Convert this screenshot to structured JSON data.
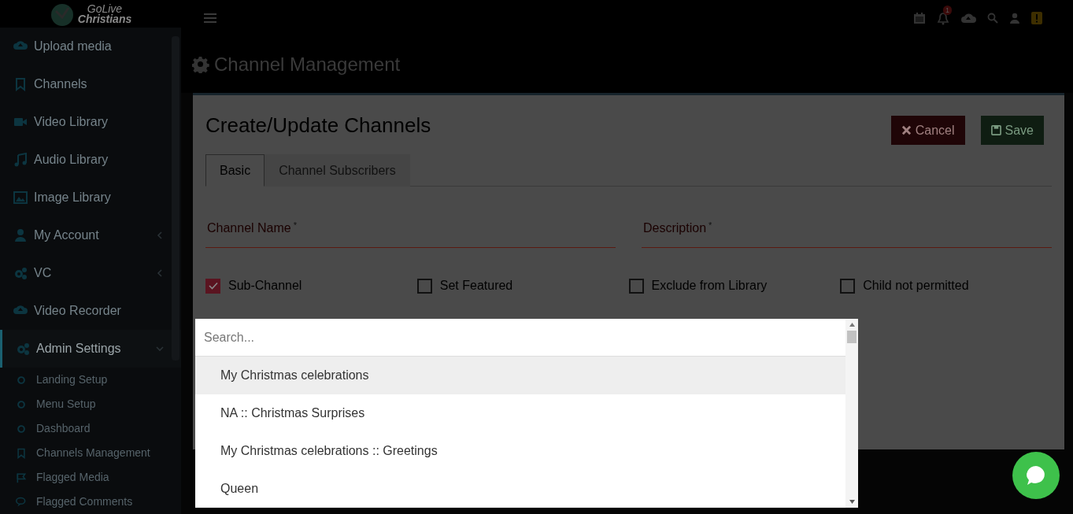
{
  "logo": {
    "line_1": "GoLive",
    "line_2": "Christians"
  },
  "sidebar": {
    "items": [
      {
        "label": "Upload media",
        "kind": "main",
        "expandable": false,
        "selected": false
      },
      {
        "label": "Channels",
        "kind": "main",
        "expandable": false,
        "selected": false
      },
      {
        "label": "Video Library",
        "kind": "main",
        "expandable": false,
        "selected": false
      },
      {
        "label": "Audio Library",
        "kind": "main",
        "expandable": false,
        "selected": false
      },
      {
        "label": "Image Library",
        "kind": "main",
        "expandable": false,
        "selected": false
      },
      {
        "label": "My Account",
        "kind": "main",
        "expandable": true,
        "selected": false
      },
      {
        "label": "VC",
        "kind": "main",
        "expandable": true,
        "selected": false
      },
      {
        "label": "Video Recorder",
        "kind": "main",
        "expandable": false,
        "selected": false
      },
      {
        "label": "Admin Settings",
        "kind": "main",
        "expandable": true,
        "selected": true
      },
      {
        "label": "Landing Setup",
        "kind": "sub",
        "expandable": false,
        "selected": false
      },
      {
        "label": "Menu Setup",
        "kind": "sub",
        "expandable": false,
        "selected": false
      },
      {
        "label": "Dashboard",
        "kind": "sub",
        "expandable": false,
        "selected": false
      },
      {
        "label": "Channels Management",
        "kind": "sub",
        "expandable": false,
        "selected": false
      },
      {
        "label": "Flagged Media",
        "kind": "sub",
        "expandable": false,
        "selected": false
      },
      {
        "label": "Flagged Comments",
        "kind": "sub",
        "expandable": false,
        "selected": false
      }
    ]
  },
  "topbar": {
    "notification_count": "1"
  },
  "page_title": "Channel Management",
  "card": {
    "title": "Create/Update Channels",
    "buttons": [
      {
        "label": "Cancel",
        "kind": "cancel"
      },
      {
        "label": "Save",
        "kind": "save"
      }
    ],
    "tabs": [
      {
        "label": "Basic",
        "selected": true
      },
      {
        "label": "Channel Subscribers",
        "selected": false
      }
    ],
    "fields": [
      {
        "label": "Channel Name",
        "required_mark": "*"
      },
      {
        "label": "Description",
        "required_mark": "*"
      }
    ],
    "checkboxes": [
      {
        "label": "Sub-Channel",
        "checked": true
      },
      {
        "label": "Set Featured",
        "checked": false
      },
      {
        "label": "Exclude from Library",
        "checked": false
      },
      {
        "label": "Child not permitted",
        "checked": false
      }
    ]
  },
  "dropdown": {
    "search": {
      "placeholder": "Search..."
    },
    "options": [
      {
        "label": "My Christmas celebrations",
        "selected": true
      },
      {
        "label": "NA :: Christmas Surprises",
        "selected": false
      },
      {
        "label": "My Christmas celebrations :: Greetings",
        "selected": false
      },
      {
        "label": "Queen",
        "selected": false
      }
    ]
  }
}
